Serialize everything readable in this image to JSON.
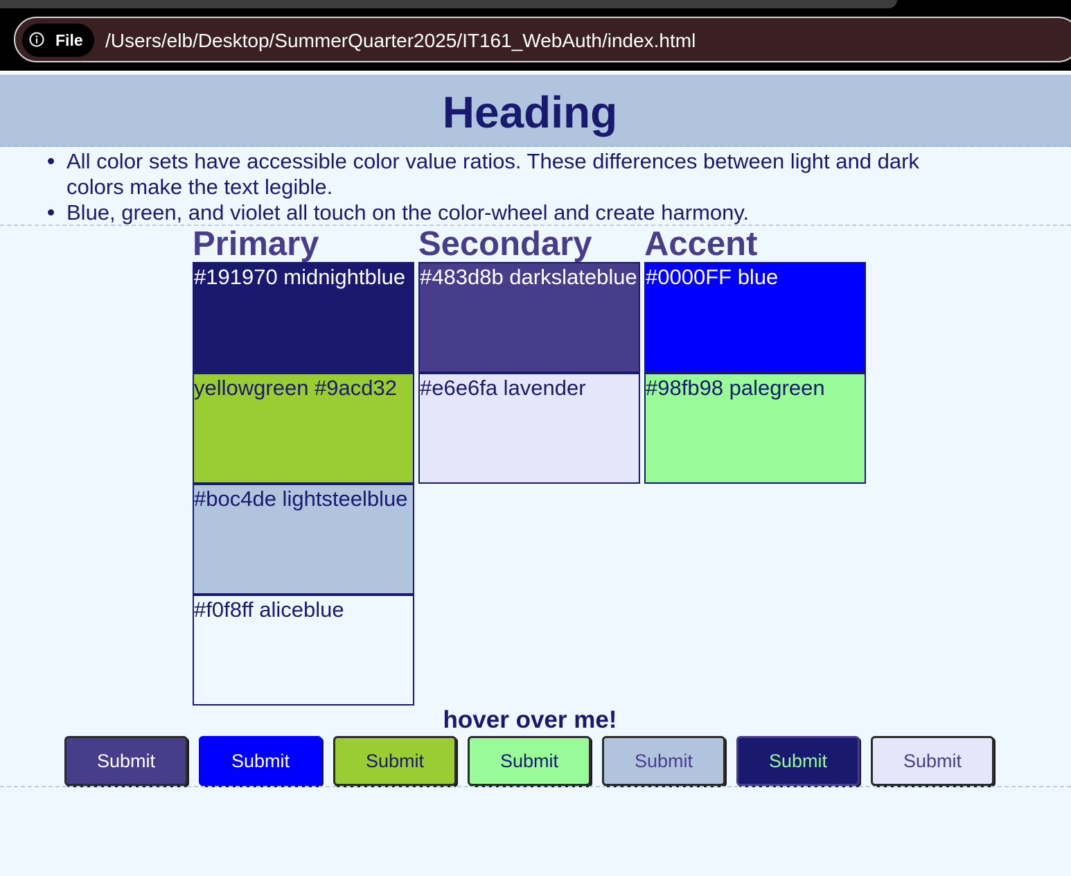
{
  "browser": {
    "site_info_label": "File",
    "url": "/Users/elb/Desktop/SummerQuarter2025/IT161_WebAuth/index.html"
  },
  "page": {
    "title": "Heading",
    "bullets": [
      "All color sets have accessible color value ratios. These differences between light and dark colors make the text legible.",
      "Blue, green, and violet all touch on the color-wheel and create harmony."
    ],
    "hover_label": "hover over me!"
  },
  "palette": {
    "primary": {
      "heading": "Primary",
      "swatches": [
        {
          "label": "#191970 midnightblue",
          "bg": "#191970",
          "fg": "#ffffff"
        },
        {
          "label": "yellowgreen #9acd32",
          "bg": "#9acd32",
          "fg": "#191970"
        },
        {
          "label": "#boc4de lightsteelblue",
          "bg": "#b0c4de",
          "fg": "#191970"
        },
        {
          "label": "#f0f8ff aliceblue",
          "bg": "#f0f8ff",
          "fg": "#191970"
        }
      ]
    },
    "secondary": {
      "heading": "Secondary",
      "swatches": [
        {
          "label": "#483d8b darkslateblue",
          "bg": "#483d8b",
          "fg": "#ffffff"
        },
        {
          "label": "#e6e6fa lavender",
          "bg": "#e6e6fa",
          "fg": "#191970"
        }
      ]
    },
    "accent": {
      "heading": "Accent",
      "swatches": [
        {
          "label": "#0000FF blue",
          "bg": "#0000ff",
          "fg": "#ffffff"
        },
        {
          "label": "#98fb98 palegreen",
          "bg": "#98fb98",
          "fg": "#191970"
        }
      ]
    }
  },
  "buttons": [
    {
      "label": "Submit",
      "bg": "#483d8b",
      "fg": "#ffffff",
      "border": "#2b2b2b"
    },
    {
      "label": "Submit",
      "bg": "#0000ff",
      "fg": "#ffffff",
      "border": "#0000ff"
    },
    {
      "label": "Submit",
      "bg": "#9acd32",
      "fg": "#191970",
      "border": "#2b2b2b"
    },
    {
      "label": "Submit",
      "bg": "#98fb98",
      "fg": "#191970",
      "border": "#2b2b2b"
    },
    {
      "label": "Submit",
      "bg": "#b0c4de",
      "fg": "#483d8b",
      "border": "#2b2b2b"
    },
    {
      "label": "Submit",
      "bg": "#191970",
      "fg": "#98fb98",
      "border": "#483d8b"
    },
    {
      "label": "Submit",
      "bg": "#e6e6fa",
      "fg": "#483d8b",
      "border": "#2b2b2b"
    }
  ]
}
